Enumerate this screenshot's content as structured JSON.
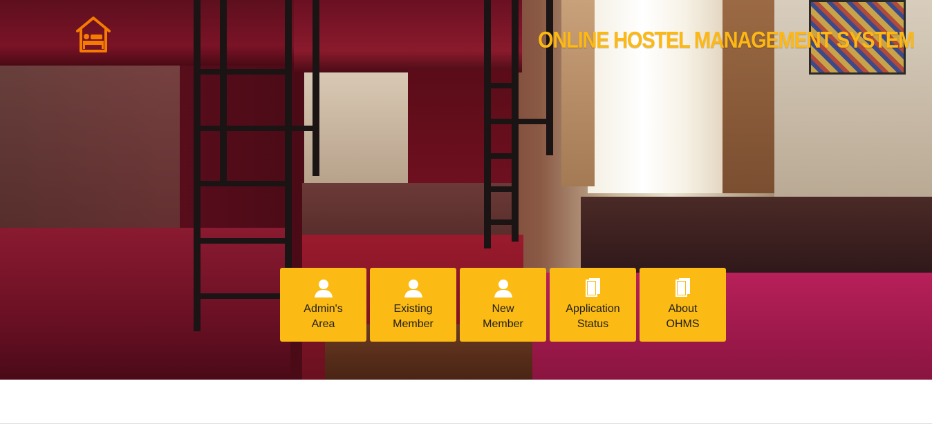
{
  "header": {
    "title": "ONLINE HOSTEL MANAGEMENT SYSTEM",
    "title_color": "#fdb813",
    "logo_icon": "hostel-bed-icon",
    "logo_color": "#f57c00"
  },
  "menu": {
    "tile_color": "#fbba14",
    "items": [
      {
        "label": "Admin's\nArea",
        "icon": "user-icon"
      },
      {
        "label": "Existing\nMember",
        "icon": "user-icon"
      },
      {
        "label": "New\nMember",
        "icon": "user-icon"
      },
      {
        "label": "Application\nStatus",
        "icon": "book-icon"
      },
      {
        "label": "About\nOHMS",
        "icon": "book-icon"
      }
    ]
  }
}
